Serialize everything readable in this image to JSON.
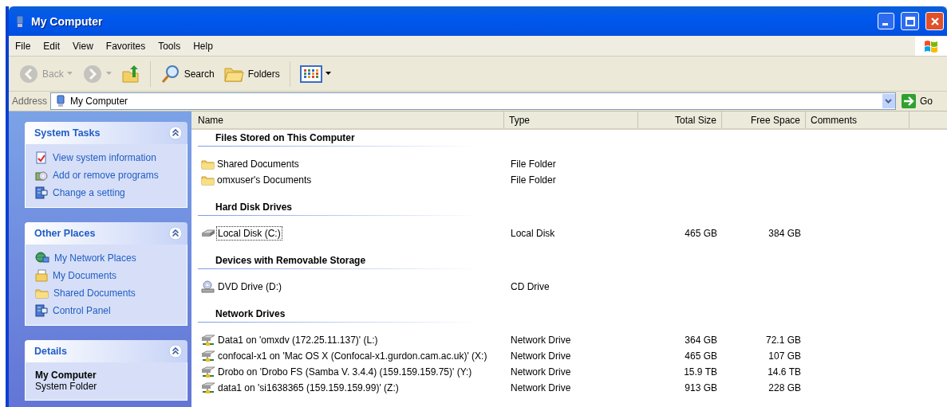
{
  "window": {
    "title": "My Computer"
  },
  "menu": [
    "File",
    "Edit",
    "View",
    "Favorites",
    "Tools",
    "Help"
  ],
  "toolbar": [
    {
      "kind": "back",
      "label": "Back",
      "disabled": true
    },
    {
      "kind": "forward",
      "disabled": true
    },
    {
      "kind": "up",
      "disabled": false
    },
    {
      "kind": "search",
      "label": "Search",
      "disabled": false
    },
    {
      "kind": "folders",
      "label": "Folders",
      "disabled": false
    },
    {
      "kind": "views",
      "disabled": false
    }
  ],
  "address": {
    "label": "Address",
    "value": "My Computer",
    "go": "Go"
  },
  "sidebar": {
    "panels": [
      {
        "title": "System Tasks",
        "expanded": true,
        "items": [
          {
            "kind": "sysinfo",
            "label": "View system information"
          },
          {
            "kind": "programs",
            "label": "Add or remove programs"
          },
          {
            "kind": "setting",
            "label": "Change a setting"
          }
        ]
      },
      {
        "title": "Other Places",
        "expanded": true,
        "items": [
          {
            "kind": "network",
            "label": "My Network Places"
          },
          {
            "kind": "documents",
            "label": "My Documents"
          },
          {
            "kind": "folder",
            "label": "Shared Documents"
          },
          {
            "kind": "setting",
            "label": "Control Panel"
          }
        ]
      },
      {
        "title": "Details",
        "expanded": true,
        "name": "My Computer",
        "description": "System Folder"
      }
    ]
  },
  "list": {
    "columns": [
      "Name",
      "Type",
      "Total Size",
      "Free Space",
      "Comments"
    ],
    "groups": [
      {
        "title": "Files Stored on This Computer",
        "items": [
          {
            "kind": "folder",
            "name": "Shared Documents",
            "type": "File Folder",
            "focused": false
          },
          {
            "kind": "folder",
            "name": "omxuser's Documents",
            "type": "File Folder",
            "focused": false
          }
        ]
      },
      {
        "title": "Hard Disk Drives",
        "items": [
          {
            "kind": "disk",
            "name": "Local Disk (C:)",
            "type": "Local Disk",
            "total_size": "465 GB",
            "free_space": "384 GB",
            "focused": true
          }
        ]
      },
      {
        "title": "Devices with Removable Storage",
        "items": [
          {
            "kind": "dvd",
            "name": "DVD Drive (D:)",
            "type": "CD Drive",
            "focused": false
          }
        ]
      },
      {
        "title": "Network Drives",
        "items": [
          {
            "kind": "netdrive",
            "name": "Data1 on 'omxdv (172.25.11.137)' (L:)",
            "type": "Network Drive",
            "total_size": "364 GB",
            "free_space": "72.1 GB",
            "focused": false
          },
          {
            "kind": "netdrive",
            "name": "confocal-x1 on 'Mac OS X (Confocal-x1.gurdon.cam.ac.uk)' (X:)",
            "type": "Network Drive",
            "total_size": "465 GB",
            "free_space": "107 GB",
            "focused": false
          },
          {
            "kind": "netdrive",
            "name": "Drobo on 'Drobo FS (Samba V. 3.4.4) (159.159.159.75)' (Y:)",
            "type": "Network Drive",
            "total_size": "15.9 TB",
            "free_space": "14.6 TB",
            "focused": false
          },
          {
            "kind": "netdrive",
            "name": "data1 on 'si1638365 (159.159.159.99)' (Z:)",
            "type": "Network Drive",
            "total_size": "913 GB",
            "free_space": "228 GB",
            "focused": false
          }
        ]
      }
    ]
  }
}
